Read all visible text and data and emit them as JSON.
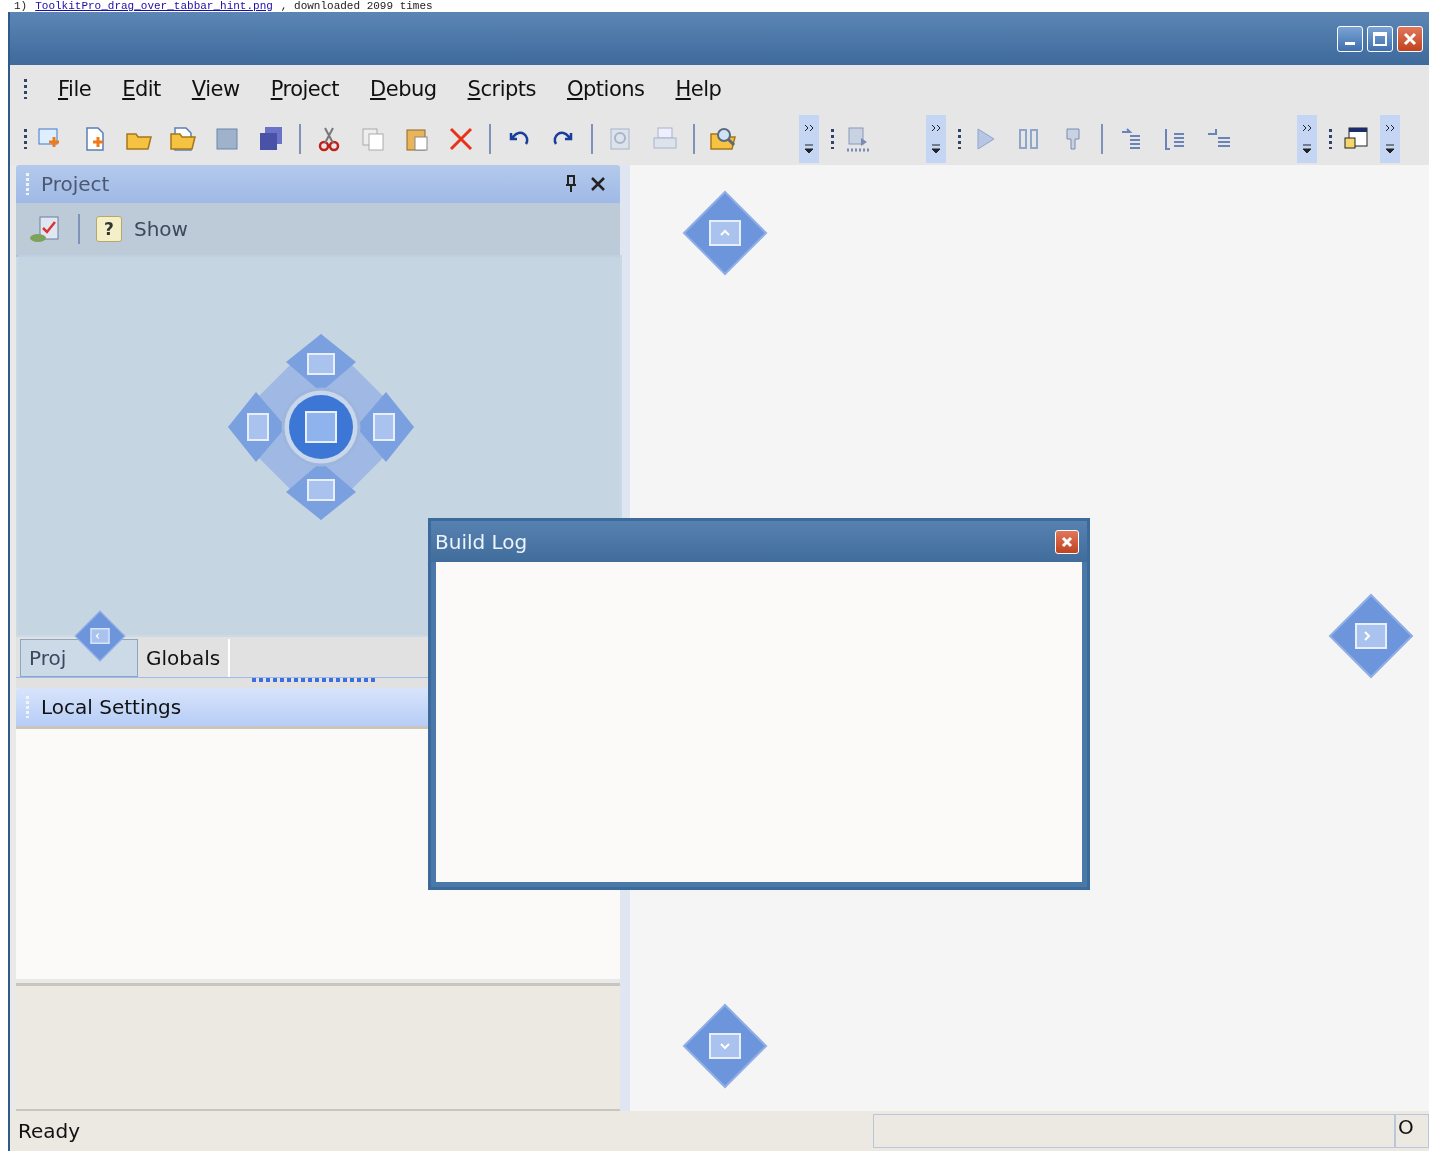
{
  "caption": {
    "index": "1)",
    "file_link": "ToolkitPro_drag_over_tabbar_hint.png",
    "text": ", downloaded 2099 times"
  },
  "menu": [
    "File",
    "Edit",
    "View",
    "Project",
    "Debug",
    "Scripts",
    "Options",
    "Help"
  ],
  "project_pane": {
    "title": "Project",
    "help_glyph": "?",
    "toolbar_label": "Show"
  },
  "pane_tabs": [
    {
      "label": "Proj",
      "selected": true
    },
    {
      "label": "Globals",
      "selected": false
    }
  ],
  "settings_pane": {
    "title": "Local Settings"
  },
  "build_log": {
    "title": "Build Log"
  },
  "status_bar": {
    "message": "Ready",
    "panel_3": "O"
  }
}
